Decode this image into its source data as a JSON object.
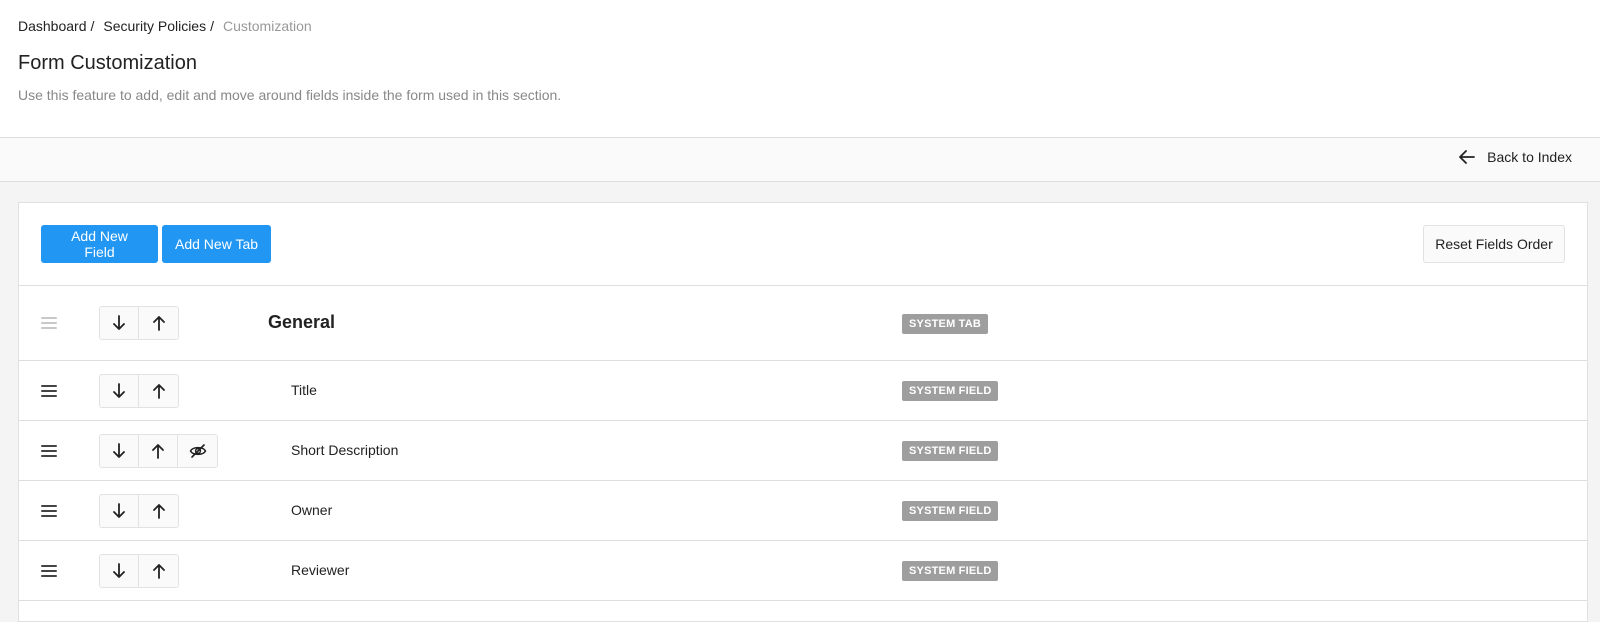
{
  "breadcrumb": {
    "items": [
      "Dashboard",
      "Security Policies"
    ],
    "separator": "/",
    "current": "Customization"
  },
  "page": {
    "title": "Form Customization",
    "description": "Use this feature to add, edit and move around fields inside the form used in this section."
  },
  "subbar": {
    "back_label": "Back to Index"
  },
  "toolbar": {
    "add_field_label": "Add New Field",
    "add_tab_label": "Add New Tab",
    "reset_label": "Reset Fields Order"
  },
  "colors": {
    "primary": "#2196f3",
    "badge": "#9e9e9e"
  },
  "rows": {
    "tab": {
      "name": "General",
      "badge": "SYSTEM TAB"
    },
    "fields": [
      {
        "name": "Title",
        "badge": "SYSTEM FIELD"
      },
      {
        "name": "Short Description",
        "badge": "SYSTEM FIELD"
      },
      {
        "name": "Owner",
        "badge": "SYSTEM FIELD"
      },
      {
        "name": "Reviewer",
        "badge": "SYSTEM FIELD"
      }
    ]
  }
}
